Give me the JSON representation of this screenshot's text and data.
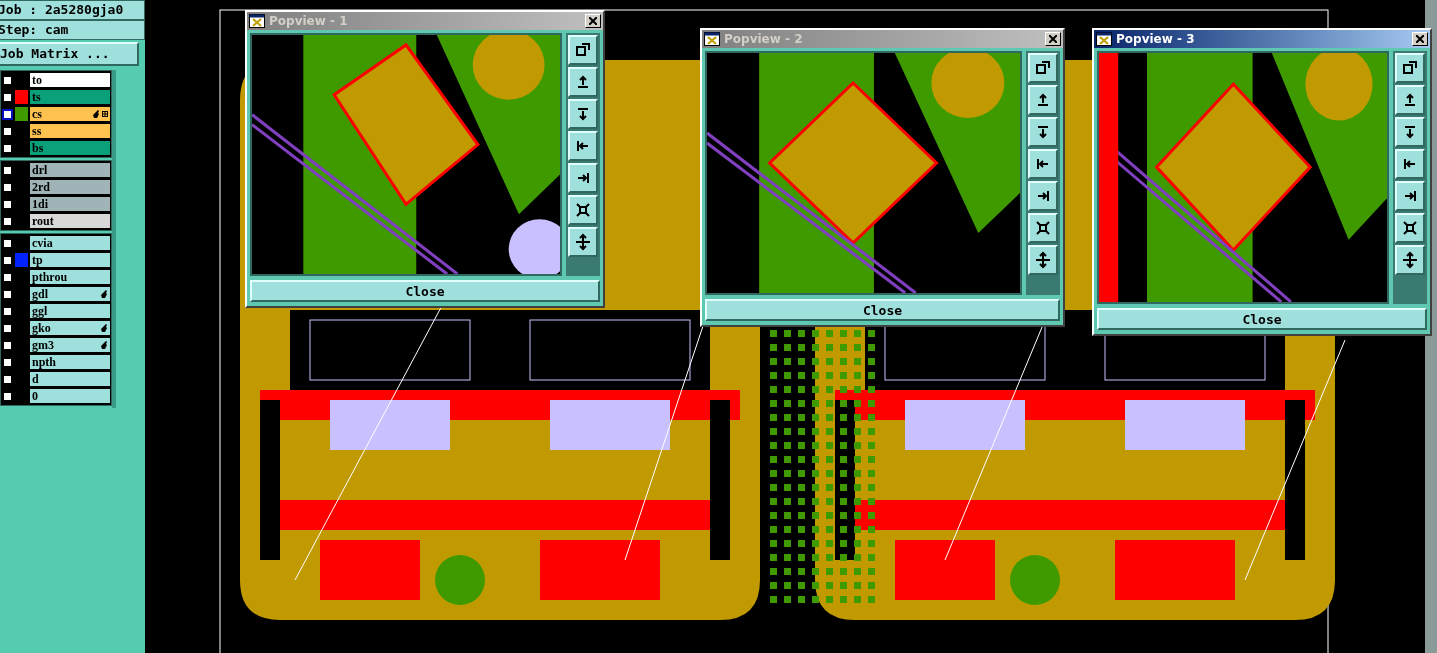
{
  "job": {
    "label": "Job : 2a5280gja0",
    "step": "Step: cam",
    "matrix_button": "Job Matrix ..."
  },
  "layer_groups": [
    [
      {
        "name": "to",
        "kind": "doc",
        "checked": false,
        "work": false,
        "affected": false
      },
      {
        "name": "ts",
        "kind": "mask",
        "color": "#ff0000",
        "checked": false,
        "work": false,
        "affected": false
      },
      {
        "name": "cs",
        "kind": "signal",
        "color": "#3f9a00",
        "checked": false,
        "work": true,
        "affected": true
      },
      {
        "name": "ss",
        "kind": "signal",
        "checked": false,
        "work": false,
        "affected": false
      },
      {
        "name": "bs",
        "kind": "mask",
        "checked": false,
        "work": false,
        "affected": false
      }
    ],
    [
      {
        "name": "drl",
        "kind": "drill",
        "checked": false,
        "work": false,
        "affected": false
      },
      {
        "name": "2rd",
        "kind": "drill",
        "checked": false,
        "work": false,
        "affected": false
      },
      {
        "name": "1di",
        "kind": "drill",
        "checked": false,
        "work": false,
        "affected": false
      },
      {
        "name": "rout",
        "kind": "rout",
        "checked": false,
        "work": false,
        "affected": false
      }
    ],
    [
      {
        "name": "cvia",
        "kind": "misc",
        "checked": false,
        "work": false,
        "affected": false
      },
      {
        "name": "tp",
        "kind": "misc",
        "color": "#0022ff",
        "checked": false,
        "work": false,
        "affected": false
      },
      {
        "name": "pthrou",
        "kind": "misc",
        "checked": false,
        "work": false,
        "affected": false
      },
      {
        "name": "gdl",
        "kind": "misc",
        "checked": false,
        "work": false,
        "affected": true
      },
      {
        "name": "ggl",
        "kind": "misc",
        "checked": false,
        "work": false,
        "affected": false
      },
      {
        "name": "gko",
        "kind": "misc",
        "checked": false,
        "work": false,
        "affected": true
      },
      {
        "name": "gm3",
        "kind": "misc",
        "checked": false,
        "work": false,
        "affected": true
      },
      {
        "name": "npth",
        "kind": "misc",
        "checked": false,
        "work": false,
        "affected": false
      },
      {
        "name": "d",
        "kind": "misc",
        "checked": false,
        "work": false,
        "affected": false
      },
      {
        "name": "0",
        "kind": "misc",
        "checked": false,
        "work": false,
        "affected": false
      }
    ]
  ],
  "popviews": [
    {
      "title": "Popview - 1",
      "active": false,
      "close": "Close"
    },
    {
      "title": "Popview - 2",
      "active": false,
      "close": "Close"
    },
    {
      "title": "Popview - 3",
      "active": true,
      "close": "Close"
    }
  ]
}
